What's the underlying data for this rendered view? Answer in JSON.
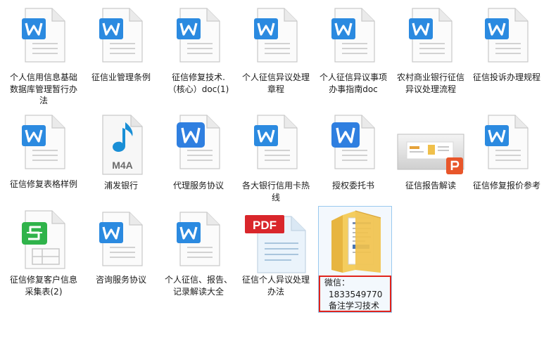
{
  "files": [
    {
      "label": "个人信用信息基础数据库管理暂行办法",
      "icon": "word-icon"
    },
    {
      "label": "征信业管理条例",
      "icon": "word-icon"
    },
    {
      "label": "征信修复技术.（核心）doc(1)",
      "icon": "word-icon"
    },
    {
      "label": "个人征信异议处理章程",
      "icon": "word-icon"
    },
    {
      "label": "个人征信异议事项办事指南doc",
      "icon": "word-icon"
    },
    {
      "label": "农村商业银行征信异议处理流程",
      "icon": "word-icon"
    },
    {
      "label": "征信投诉办理规程",
      "icon": "word-icon"
    },
    {
      "label": "征信修复表格样例",
      "icon": "word-icon"
    },
    {
      "label": "浦发银行",
      "icon": "m4a-audio-icon",
      "badge": "M4A"
    },
    {
      "label": "代理服务协议",
      "icon": "word-icon-blue-tile"
    },
    {
      "label": "各大银行信用卡热线",
      "icon": "word-icon"
    },
    {
      "label": "授权委托书",
      "icon": "word-icon-blue-tile"
    },
    {
      "label": "征信报告解读",
      "icon": "powerpoint-icon"
    },
    {
      "label": "征信修复报价参考",
      "icon": "word-icon"
    },
    {
      "label": "征信修复客户信息采集表(2)",
      "icon": "spreadsheet-icon"
    },
    {
      "label": "咨询服务协议",
      "icon": "word-icon"
    },
    {
      "label": "个人征信、报告、记录解读大全",
      "icon": "word-icon"
    },
    {
      "label": "征信个人异议处理办法",
      "icon": "pdf-icon",
      "badge": "PDF"
    },
    {
      "label": "",
      "icon": "folder-icon"
    }
  ],
  "wechat": {
    "line1": "微信：",
    "line2": "1833549770",
    "line3": "备注学习技术"
  },
  "colors": {
    "word_blue": "#2b8ae0",
    "selection_border": "#99c9ef",
    "highlight_red": "#e0231c",
    "spreadsheet_green": "#2fb34a",
    "pdf_red": "#d9262b",
    "audio_blue": "#1a8fd6",
    "ppt_orange": "#e8562a",
    "folder_yellow": "#f1c24d"
  }
}
